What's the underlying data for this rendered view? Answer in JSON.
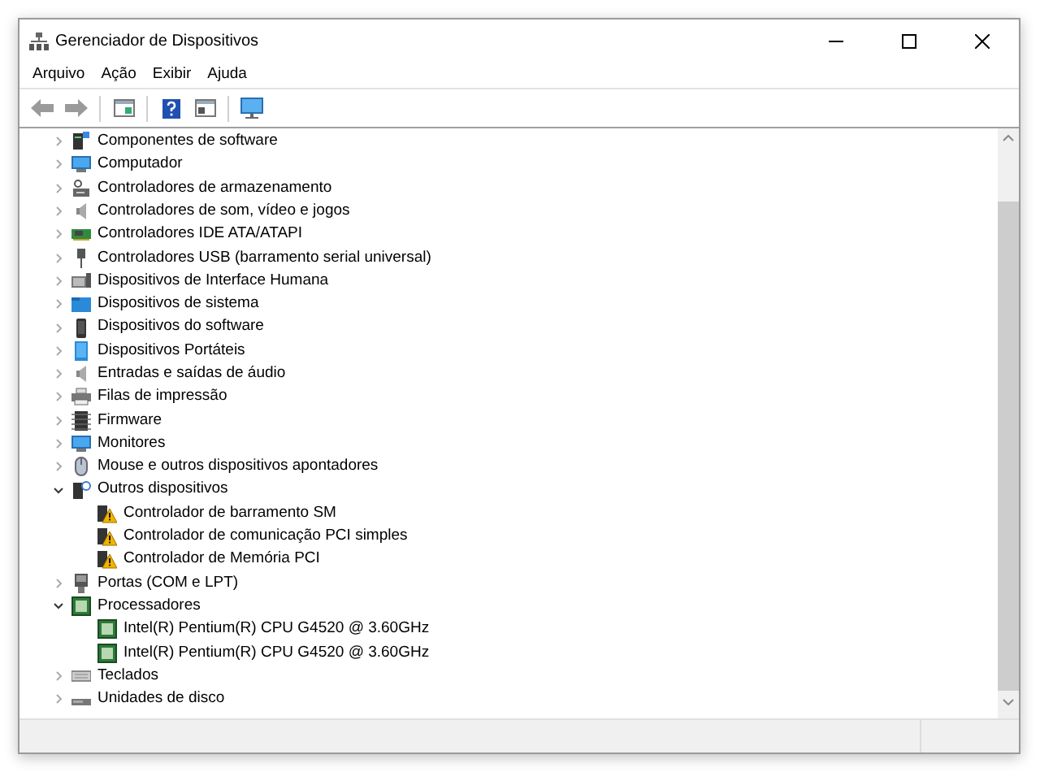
{
  "window": {
    "title": "Gerenciador de Dispositivos"
  },
  "menu": [
    "Arquivo",
    "Ação",
    "Exibir",
    "Ajuda"
  ],
  "toolbar": [
    {
      "kind": "back",
      "disabled": true
    },
    {
      "kind": "forward",
      "disabled": true
    },
    {
      "kind": "sep"
    },
    {
      "kind": "properties"
    },
    {
      "kind": "sep"
    },
    {
      "kind": "help"
    },
    {
      "kind": "panel"
    },
    {
      "kind": "sep"
    },
    {
      "kind": "monitor"
    }
  ],
  "tree": [
    {
      "label": "Componentes de software",
      "kind": "software",
      "expanded": false
    },
    {
      "label": "Computador",
      "kind": "monitor",
      "expanded": false
    },
    {
      "label": "Controladores de armazenamento",
      "kind": "storage",
      "expanded": false
    },
    {
      "label": "Controladores de som, vídeo e jogos",
      "kind": "sound",
      "expanded": false
    },
    {
      "label": "Controladores IDE ATA/ATAPI",
      "kind": "ide",
      "expanded": false
    },
    {
      "label": "Controladores USB (barramento serial universal)",
      "kind": "usb",
      "expanded": false
    },
    {
      "label": "Dispositivos de Interface Humana",
      "kind": "hid",
      "expanded": false
    },
    {
      "label": "Dispositivos de sistema",
      "kind": "system",
      "expanded": false
    },
    {
      "label": "Dispositivos do software",
      "kind": "phone",
      "expanded": false
    },
    {
      "label": "Dispositivos Portáteis",
      "kind": "portable",
      "expanded": false
    },
    {
      "label": "Entradas e saídas de áudio",
      "kind": "sound",
      "expanded": false
    },
    {
      "label": "Filas de impressão",
      "kind": "printer",
      "expanded": false
    },
    {
      "label": "Firmware",
      "kind": "firmware",
      "expanded": false
    },
    {
      "label": "Monitores",
      "kind": "monitor",
      "expanded": false
    },
    {
      "label": "Mouse e outros dispositivos apontadores",
      "kind": "mouse",
      "expanded": false
    },
    {
      "label": "Outros dispositivos",
      "kind": "other",
      "expanded": true,
      "children": [
        {
          "label": "Controlador de barramento SM",
          "kind": "warning"
        },
        {
          "label": "Controlador de comunicação PCI simples",
          "kind": "warning"
        },
        {
          "label": "Controlador de Memória PCI",
          "kind": "warning"
        }
      ]
    },
    {
      "label": "Portas (COM e LPT)",
      "kind": "port",
      "expanded": false
    },
    {
      "label": "Processadores",
      "kind": "cpu",
      "expanded": true,
      "children": [
        {
          "label": "Intel(R) Pentium(R) CPU G4520 @ 3.60GHz",
          "kind": "cpu"
        },
        {
          "label": "Intel(R) Pentium(R) CPU G4520 @ 3.60GHz",
          "kind": "cpu"
        }
      ]
    },
    {
      "label": "Teclados",
      "kind": "keyboard",
      "expanded": false
    },
    {
      "label": "Unidades de disco",
      "kind": "disk",
      "expanded": false
    }
  ]
}
